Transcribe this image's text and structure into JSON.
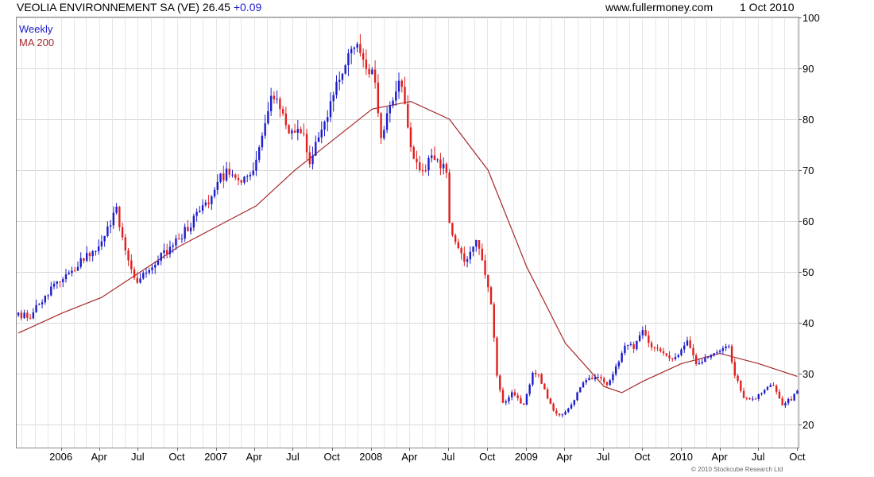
{
  "header": {
    "title": "VEOLIA ENVIRONNEMENT SA (VE) 26.45",
    "change": "+0.09",
    "site": "www.fullermoney.com",
    "date": "1 Oct 2010"
  },
  "copyright": "© 2010 Stockcube Research Ltd",
  "colors": {
    "up": "#1c1ccc",
    "down": "#e02020",
    "ma": "#a52a2a",
    "grid": "#d8d8d8"
  },
  "chart_data": {
    "type": "candlestick",
    "period": "Weekly",
    "indicator": "MA 200",
    "legend": [
      "Weekly",
      "MA 200"
    ],
    "y_axis": {
      "ylim": [
        15.5,
        100
      ],
      "ticks": [
        20,
        30,
        40,
        50,
        60,
        70,
        80,
        90,
        100
      ],
      "position": "right"
    },
    "x_axis": {
      "start": "2005-09-19",
      "end": "2010-10-04",
      "labels": [
        {
          "text": "2006",
          "date": "2006-01-01"
        },
        {
          "text": "Apr",
          "date": "2006-04-01"
        },
        {
          "text": "Jul",
          "date": "2006-07-01"
        },
        {
          "text": "Oct",
          "date": "2006-10-01"
        },
        {
          "text": "2007",
          "date": "2007-01-01"
        },
        {
          "text": "Apr",
          "date": "2007-04-01"
        },
        {
          "text": "Jul",
          "date": "2007-07-01"
        },
        {
          "text": "Oct",
          "date": "2007-10-01"
        },
        {
          "text": "2008",
          "date": "2008-01-01"
        },
        {
          "text": "Apr",
          "date": "2008-04-01"
        },
        {
          "text": "Jul",
          "date": "2008-07-01"
        },
        {
          "text": "Oct",
          "date": "2008-10-01"
        },
        {
          "text": "2009",
          "date": "2009-01-01"
        },
        {
          "text": "Apr",
          "date": "2009-04-01"
        },
        {
          "text": "Jul",
          "date": "2009-07-01"
        },
        {
          "text": "Oct",
          "date": "2009-10-01"
        },
        {
          "text": "2010",
          "date": "2010-01-01"
        },
        {
          "text": "Apr",
          "date": "2010-04-01"
        },
        {
          "text": "Jul",
          "date": "2010-07-01"
        },
        {
          "text": "Oct",
          "date": "2010-10-01"
        }
      ]
    },
    "grid": true,
    "close_series": [
      [
        "2005-09-23",
        41.5
      ],
      [
        "2005-10-21",
        41.5
      ],
      [
        "2005-11-25",
        45
      ],
      [
        "2005-12-23",
        48
      ],
      [
        "2006-01-20",
        50
      ],
      [
        "2006-02-17",
        52
      ],
      [
        "2006-03-17",
        54
      ],
      [
        "2006-04-14",
        57
      ],
      [
        "2006-05-12",
        62
      ],
      [
        "2006-05-26",
        56
      ],
      [
        "2006-06-16",
        50
      ],
      [
        "2006-06-30",
        48
      ],
      [
        "2006-07-28",
        51
      ],
      [
        "2006-08-25",
        53
      ],
      [
        "2006-09-22",
        55
      ],
      [
        "2006-10-20",
        58
      ],
      [
        "2006-11-17",
        61
      ],
      [
        "2006-12-15",
        64
      ],
      [
        "2007-01-05",
        68
      ],
      [
        "2007-02-02",
        70
      ],
      [
        "2007-03-02",
        68
      ],
      [
        "2007-03-30",
        70
      ],
      [
        "2007-04-20",
        76
      ],
      [
        "2007-05-11",
        85
      ],
      [
        "2007-06-01",
        82
      ],
      [
        "2007-06-22",
        78
      ],
      [
        "2007-07-20",
        78
      ],
      [
        "2007-08-10",
        72
      ],
      [
        "2007-08-31",
        76
      ],
      [
        "2007-09-28",
        83
      ],
      [
        "2007-10-19",
        88
      ],
      [
        "2007-11-09",
        92
      ],
      [
        "2007-11-30",
        96
      ],
      [
        "2007-12-21",
        90
      ],
      [
        "2008-01-11",
        88
      ],
      [
        "2008-01-25",
        76
      ],
      [
        "2008-02-15",
        82
      ],
      [
        "2008-03-07",
        88
      ],
      [
        "2008-03-21",
        83
      ],
      [
        "2008-04-04",
        74
      ],
      [
        "2008-04-25",
        70
      ],
      [
        "2008-05-23",
        72
      ],
      [
        "2008-06-13",
        71
      ],
      [
        "2008-06-27",
        70
      ],
      [
        "2008-07-04",
        60
      ],
      [
        "2008-07-25",
        54
      ],
      [
        "2008-08-15",
        52
      ],
      [
        "2008-09-05",
        56
      ],
      [
        "2008-09-26",
        50
      ],
      [
        "2008-10-10",
        44
      ],
      [
        "2008-10-24",
        30
      ],
      [
        "2008-11-07",
        24
      ],
      [
        "2008-11-28",
        26
      ],
      [
        "2008-12-26",
        24
      ],
      [
        "2009-01-16",
        30
      ],
      [
        "2009-01-30",
        30
      ],
      [
        "2009-02-20",
        25
      ],
      [
        "2009-03-06",
        23
      ],
      [
        "2009-03-20",
        22
      ],
      [
        "2009-04-10",
        23
      ],
      [
        "2009-05-01",
        26
      ],
      [
        "2009-05-22",
        29
      ],
      [
        "2009-06-19",
        29
      ],
      [
        "2009-07-10",
        28
      ],
      [
        "2009-07-31",
        31
      ],
      [
        "2009-08-21",
        36
      ],
      [
        "2009-09-11",
        35
      ],
      [
        "2009-10-02",
        39
      ],
      [
        "2009-10-23",
        35
      ],
      [
        "2009-11-20",
        34
      ],
      [
        "2009-12-18",
        33
      ],
      [
        "2010-01-15",
        36
      ],
      [
        "2010-02-05",
        32
      ],
      [
        "2010-03-05",
        33
      ],
      [
        "2010-04-02",
        35
      ],
      [
        "2010-04-23",
        35
      ],
      [
        "2010-05-07",
        30
      ],
      [
        "2010-05-28",
        25
      ],
      [
        "2010-06-25",
        25
      ],
      [
        "2010-07-16",
        27
      ],
      [
        "2010-08-06",
        28
      ],
      [
        "2010-08-27",
        24
      ],
      [
        "2010-09-17",
        25
      ],
      [
        "2010-10-01",
        26.45
      ]
    ],
    "ma200": [
      [
        "2005-09-23",
        38
      ],
      [
        "2006-01-06",
        42
      ],
      [
        "2006-04-07",
        45
      ],
      [
        "2006-07-07",
        50
      ],
      [
        "2006-10-06",
        55
      ],
      [
        "2007-01-05",
        59
      ],
      [
        "2007-04-06",
        63
      ],
      [
        "2007-07-06",
        70
      ],
      [
        "2007-10-05",
        76
      ],
      [
        "2008-01-04",
        82
      ],
      [
        "2008-04-04",
        83.5
      ],
      [
        "2008-07-04",
        80
      ],
      [
        "2008-10-03",
        70
      ],
      [
        "2009-01-02",
        51
      ],
      [
        "2009-04-03",
        36
      ],
      [
        "2009-07-03",
        27.5
      ],
      [
        "2009-08-14",
        26.3
      ],
      [
        "2009-10-02",
        28.5
      ],
      [
        "2010-01-01",
        32
      ],
      [
        "2010-04-02",
        34
      ],
      [
        "2010-07-02",
        32
      ],
      [
        "2010-10-01",
        29.5
      ]
    ],
    "last_close": 26.45,
    "last_change": 0.09
  }
}
